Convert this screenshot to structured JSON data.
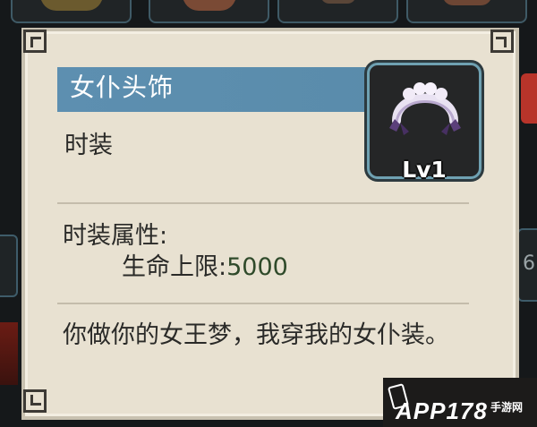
{
  "item": {
    "name": "女仆头饰",
    "category": "时装",
    "level": "Lv1",
    "icon": "maid-headdress-icon"
  },
  "attributes": {
    "header": "时装属性:",
    "rows": [
      {
        "label": "生命上限:",
        "value": "5000"
      }
    ]
  },
  "description": "你做你的女王梦，我穿我的女仆装。",
  "watermark": {
    "brand": "APP178",
    "sub": "手游网"
  },
  "side": {
    "right_number": "6"
  },
  "colors": {
    "title_bar": "#5d8fb0",
    "panel_bg": "#e8e1d1",
    "frame_border": "#6fa1b2",
    "value_green": "#2f4a2a"
  }
}
